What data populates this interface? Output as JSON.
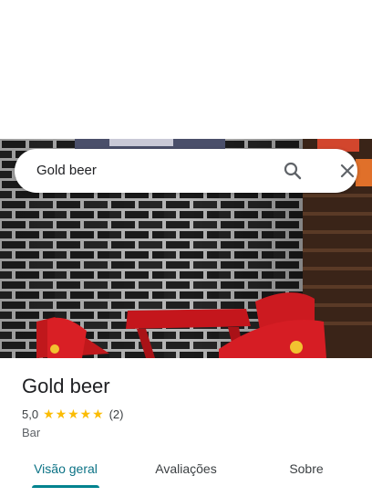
{
  "search": {
    "query": "Gold beer"
  },
  "place": {
    "name": "Gold beer",
    "rating": "5,0",
    "stars": 5,
    "review_count": "(2)",
    "category": "Bar"
  },
  "tabs": [
    {
      "label": "Visão geral",
      "active": true
    },
    {
      "label": "Avaliações",
      "active": false
    },
    {
      "label": "Sobre",
      "active": false
    }
  ],
  "icons": {
    "search": "search-icon",
    "close": "close-icon",
    "star": "star-icon"
  },
  "colors": {
    "accent": "#00838f",
    "star": "#fbbc04",
    "text": "#202124"
  }
}
